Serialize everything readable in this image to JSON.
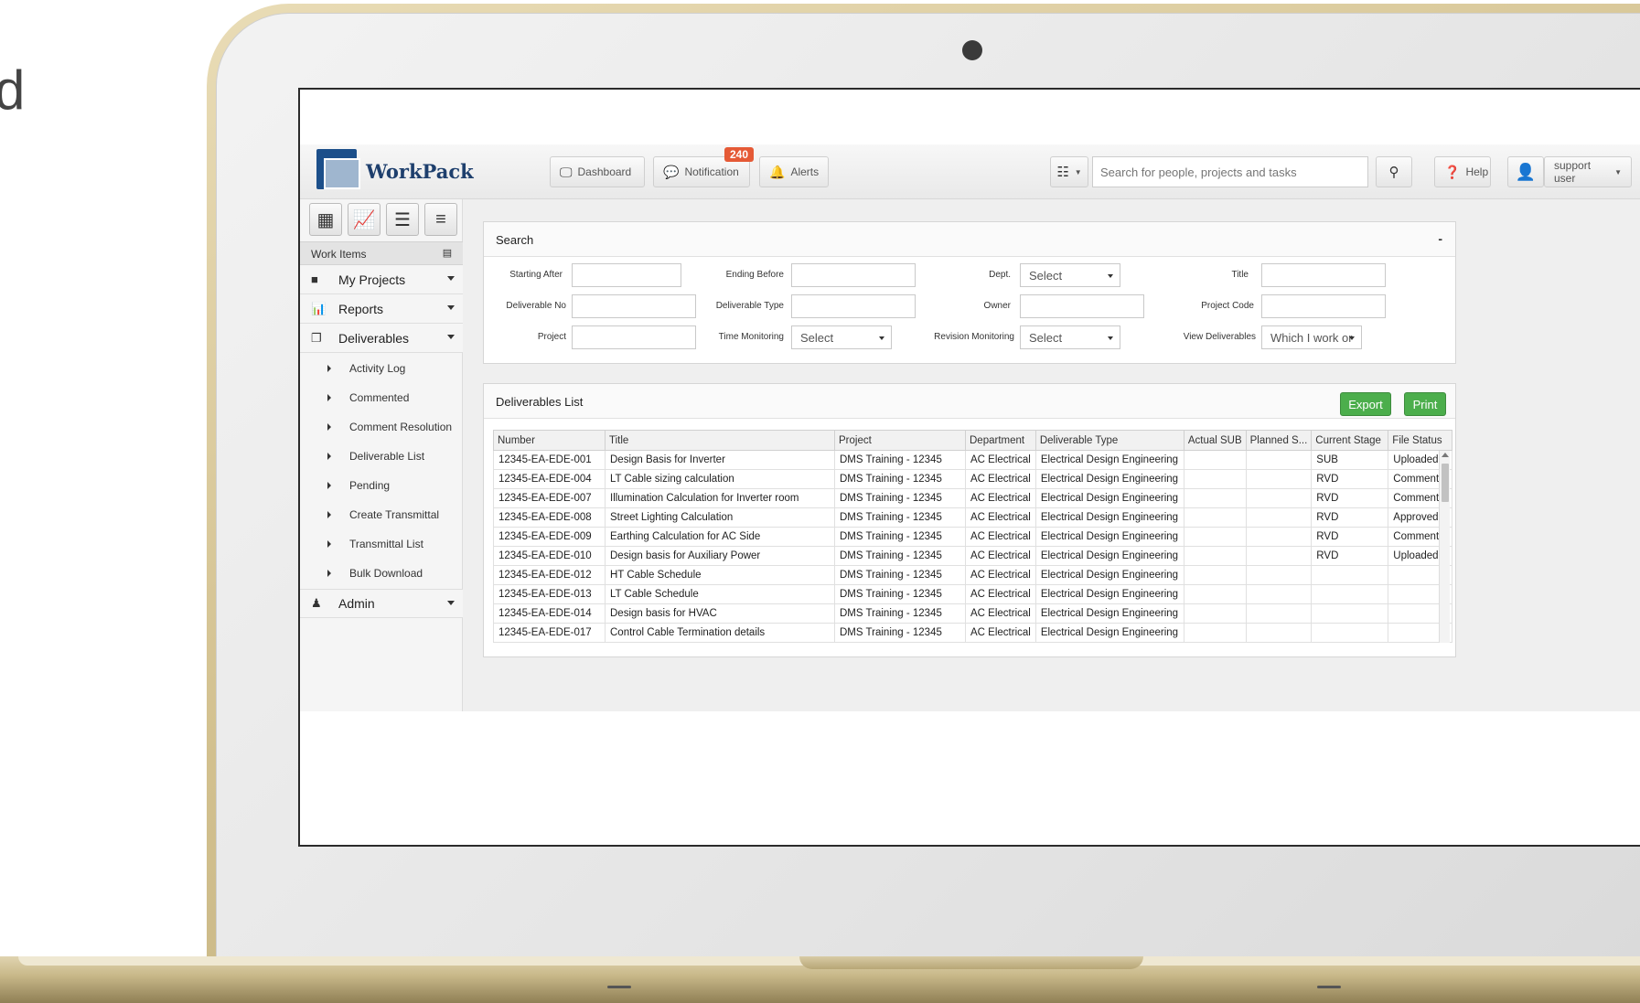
{
  "edge_text": "d",
  "app": {
    "logo_text": "WorkPack",
    "toolbar": {
      "dashboard": "Dashboard",
      "notification": "Notification",
      "notification_count": "240",
      "alerts": "Alerts",
      "search_placeholder": "Search for people, projects and tasks",
      "help": "Help",
      "user": "support user"
    },
    "sidebar": {
      "work_items": "Work Items",
      "items": [
        {
          "label": "My Projects"
        },
        {
          "label": "Reports"
        },
        {
          "label": "Deliverables"
        },
        {
          "label": "Admin"
        }
      ],
      "sub_items": [
        "Activity Log",
        "Commented",
        "Comment Resolution",
        "Deliverable List",
        "Pending",
        "Create Transmittal",
        "Transmittal List",
        "Bulk Download"
      ]
    },
    "search_panel": {
      "title": "Search",
      "collapse": "-",
      "labels": {
        "starting_after": "Starting After",
        "ending_before": "Ending Before",
        "dept": "Dept.",
        "title": "Title",
        "deliverable_no": "Deliverable No",
        "deliverable_type": "Deliverable Type",
        "owner": "Owner",
        "project_code": "Project Code",
        "project": "Project",
        "time_monitoring": "Time Monitoring",
        "revision_monitoring": "Revision Monitoring",
        "view_deliverables": "View Deliverables"
      },
      "values": {
        "dept": "Select",
        "time_monitoring": "Select",
        "revision_monitoring": "Select",
        "view_deliverables": "Which I work or"
      }
    },
    "list_panel": {
      "title": "Deliverables List",
      "export": "Export",
      "print": "Print",
      "columns": [
        "Number",
        "Title",
        "Project",
        "Department",
        "Deliverable Type",
        "Actual SUB",
        "Planned S...",
        "Current Stage",
        "File Status"
      ],
      "rows": [
        [
          "12345-EA-EDE-001",
          "Design Basis for Inverter",
          "DMS Training - 12345",
          "AC Electrical",
          "Electrical Design Engineering",
          "",
          "",
          "SUB",
          "Uploaded"
        ],
        [
          "12345-EA-EDE-004",
          "LT Cable sizing calculation",
          "DMS Training - 12345",
          "AC Electrical",
          "Electrical Design Engineering",
          "",
          "",
          "RVD",
          "Comment"
        ],
        [
          "12345-EA-EDE-007",
          "Illumination Calculation for Inverter room",
          "DMS Training - 12345",
          "AC Electrical",
          "Electrical Design Engineering",
          "",
          "",
          "RVD",
          "Comment"
        ],
        [
          "12345-EA-EDE-008",
          "Street Lighting Calculation",
          "DMS Training - 12345",
          "AC Electrical",
          "Electrical Design Engineering",
          "",
          "",
          "RVD",
          "Approved"
        ],
        [
          "12345-EA-EDE-009",
          "Earthing Calculation for AC Side",
          "DMS Training - 12345",
          "AC Electrical",
          "Electrical Design Engineering",
          "",
          "",
          "RVD",
          "Comment"
        ],
        [
          "12345-EA-EDE-010",
          "Design basis for Auxiliary Power",
          "DMS Training - 12345",
          "AC Electrical",
          "Electrical Design Engineering",
          "",
          "",
          "RVD",
          "Uploaded"
        ],
        [
          "12345-EA-EDE-012",
          "HT Cable Schedule",
          "DMS Training - 12345",
          "AC Electrical",
          "Electrical Design Engineering",
          "",
          "",
          "",
          ""
        ],
        [
          "12345-EA-EDE-013",
          "LT Cable Schedule",
          "DMS Training - 12345",
          "AC Electrical",
          "Electrical Design Engineering",
          "",
          "",
          "",
          ""
        ],
        [
          "12345-EA-EDE-014",
          "Design basis for HVAC",
          "DMS Training - 12345",
          "AC Electrical",
          "Electrical Design Engineering",
          "",
          "",
          "",
          ""
        ],
        [
          "12345-EA-EDE-017",
          "Control Cable Termination details",
          "DMS Training - 12345",
          "AC Electrical",
          "Electrical Design Engineering",
          "",
          "",
          "",
          ""
        ]
      ]
    }
  }
}
